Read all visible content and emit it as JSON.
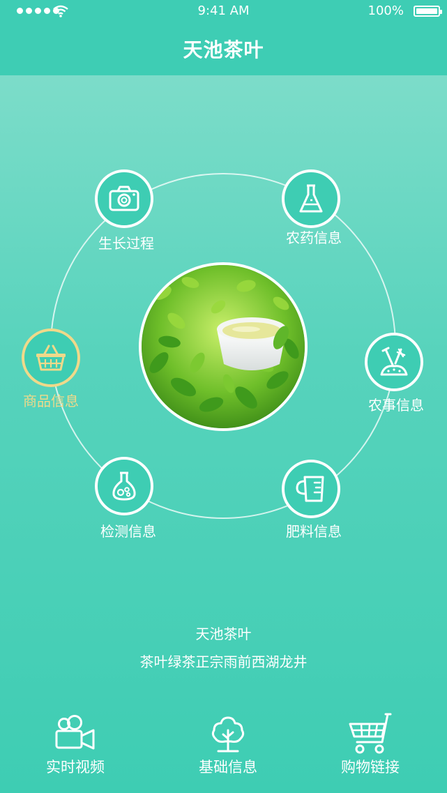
{
  "status_bar": {
    "time": "9:41 AM",
    "battery_percent": "100%"
  },
  "header": {
    "title": "天池茶叶"
  },
  "menu": {
    "items": [
      {
        "label": "生长过程",
        "icon": "camera-icon",
        "active": false
      },
      {
        "label": "农药信息",
        "icon": "flask-icon",
        "active": false
      },
      {
        "label": "商品信息",
        "icon": "basket-icon",
        "active": true
      },
      {
        "label": "农事信息",
        "icon": "farm-tools-icon",
        "active": false
      },
      {
        "label": "检测信息",
        "icon": "lab-flask-icon",
        "active": false
      },
      {
        "label": "肥料信息",
        "icon": "measuring-cup-icon",
        "active": false
      }
    ]
  },
  "product": {
    "name": "天池茶叶",
    "description": "茶叶绿茶正宗雨前西湖龙井"
  },
  "bottom_nav": {
    "items": [
      {
        "label": "实时视频",
        "icon": "video-camera-icon"
      },
      {
        "label": "基础信息",
        "icon": "tree-icon"
      },
      {
        "label": "购物链接",
        "icon": "shopping-cart-icon"
      }
    ]
  },
  "colors": {
    "primary": "#3ecdb3",
    "highlight": "#efd98a",
    "white": "#ffffff"
  }
}
